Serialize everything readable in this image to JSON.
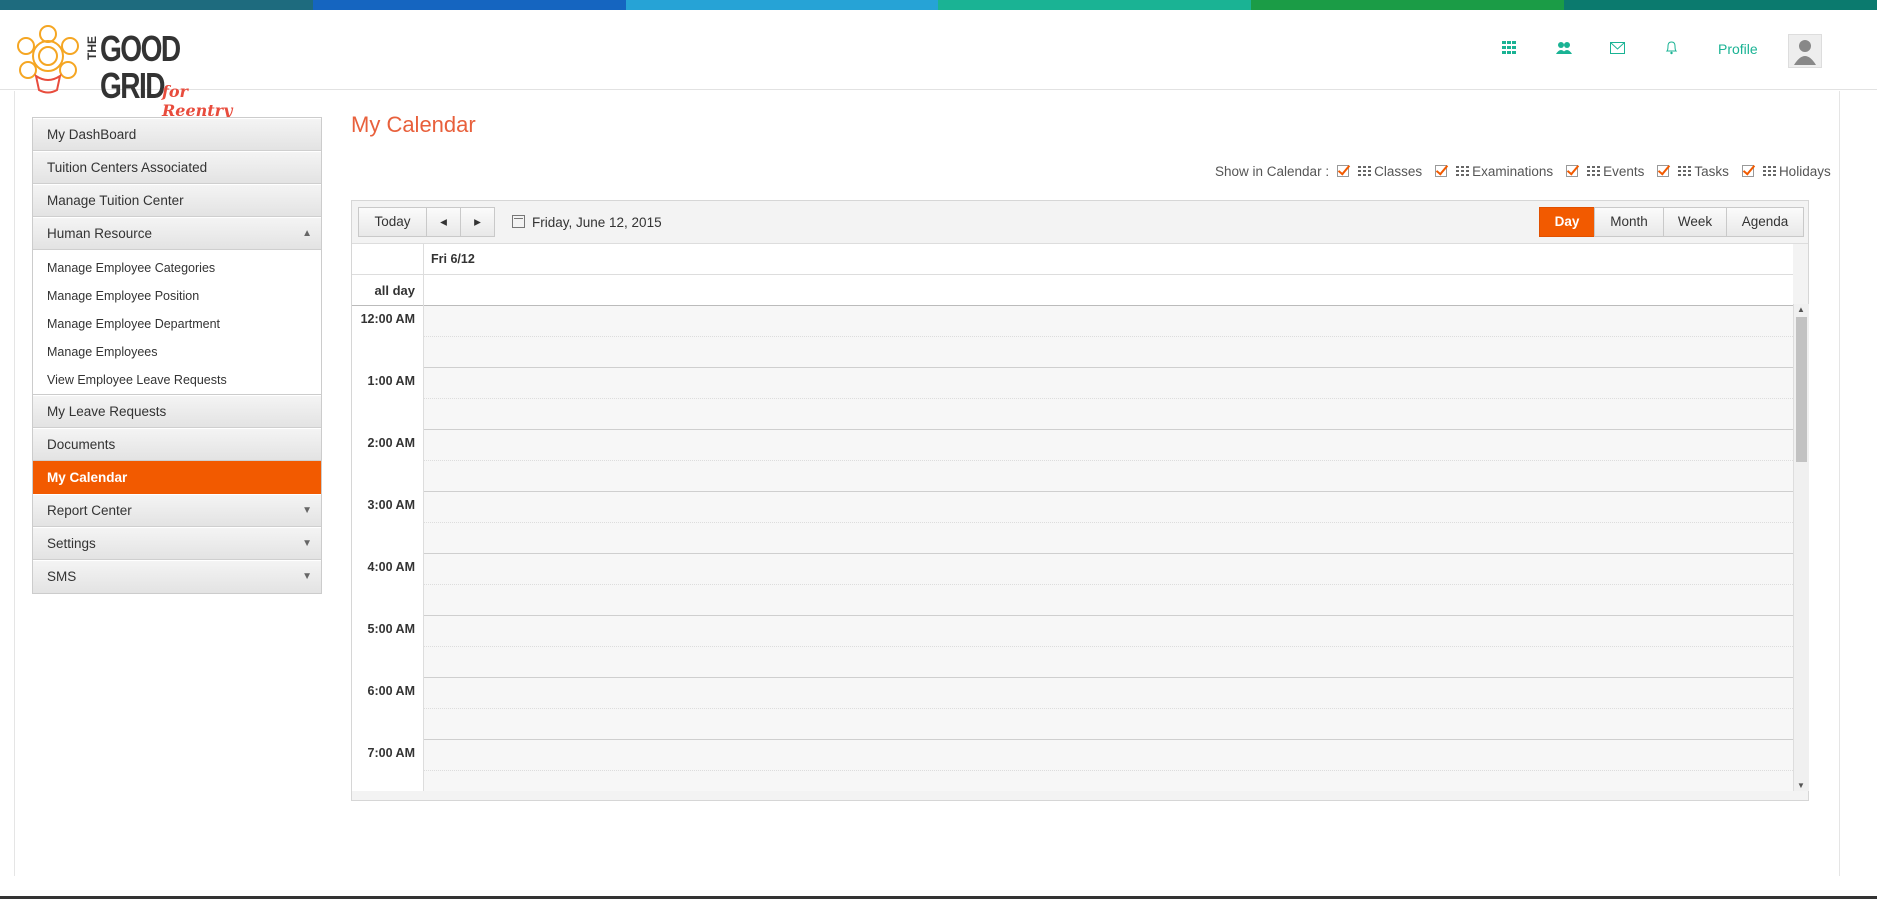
{
  "brand": {
    "logo_the": "THE",
    "logo_good": "GOOD",
    "logo_grid": "GRID",
    "logo_tagline": "for Reentry",
    "topbar_colors": [
      "#1b5e8a",
      "#1565c0",
      "#26a3d6",
      "#1b9c46",
      "#0b6e7a",
      "#1f5aa6"
    ]
  },
  "header": {
    "icons": [
      "apps-grid-icon",
      "users-icon",
      "envelope-icon",
      "bell-icon"
    ],
    "profile_label": "Profile"
  },
  "sidebar": {
    "items": [
      {
        "label": "My DashBoard"
      },
      {
        "label": "Tuition Centers Associated"
      },
      {
        "label": "Manage Tuition Center"
      },
      {
        "label": "Human Resource",
        "caret": "▲"
      },
      {
        "label": "My Leave Requests"
      },
      {
        "label": "Documents"
      },
      {
        "label": "My Calendar",
        "active": true
      },
      {
        "label": "Report Center",
        "caret": "▼"
      },
      {
        "label": "Settings",
        "caret": "▼"
      },
      {
        "label": "SMS",
        "caret": "▼"
      }
    ],
    "human_resource_sub": [
      "Manage Employee Categories",
      "Manage Employee Position",
      "Manage Employee Department",
      "Manage Employees",
      "View Employee Leave Requests"
    ]
  },
  "page": {
    "title": "My Calendar"
  },
  "filters": {
    "label": "Show in Calendar :",
    "options": [
      "Classes",
      "Examinations",
      "Events",
      "Tasks",
      "Holidays"
    ]
  },
  "calendar": {
    "today": "Today",
    "prev": "◂",
    "next": "▸",
    "date": "Friday, June 12, 2015",
    "views": [
      "Day",
      "Month",
      "Week",
      "Agenda"
    ],
    "active_view": "Day",
    "day_header": "Fri 6/12",
    "allday_label": "all day",
    "hours": [
      "12:00 AM",
      "1:00 AM",
      "2:00 AM",
      "3:00 AM",
      "4:00 AM",
      "5:00 AM",
      "6:00 AM",
      "7:00 AM"
    ]
  },
  "accent_color": "#f25a00"
}
